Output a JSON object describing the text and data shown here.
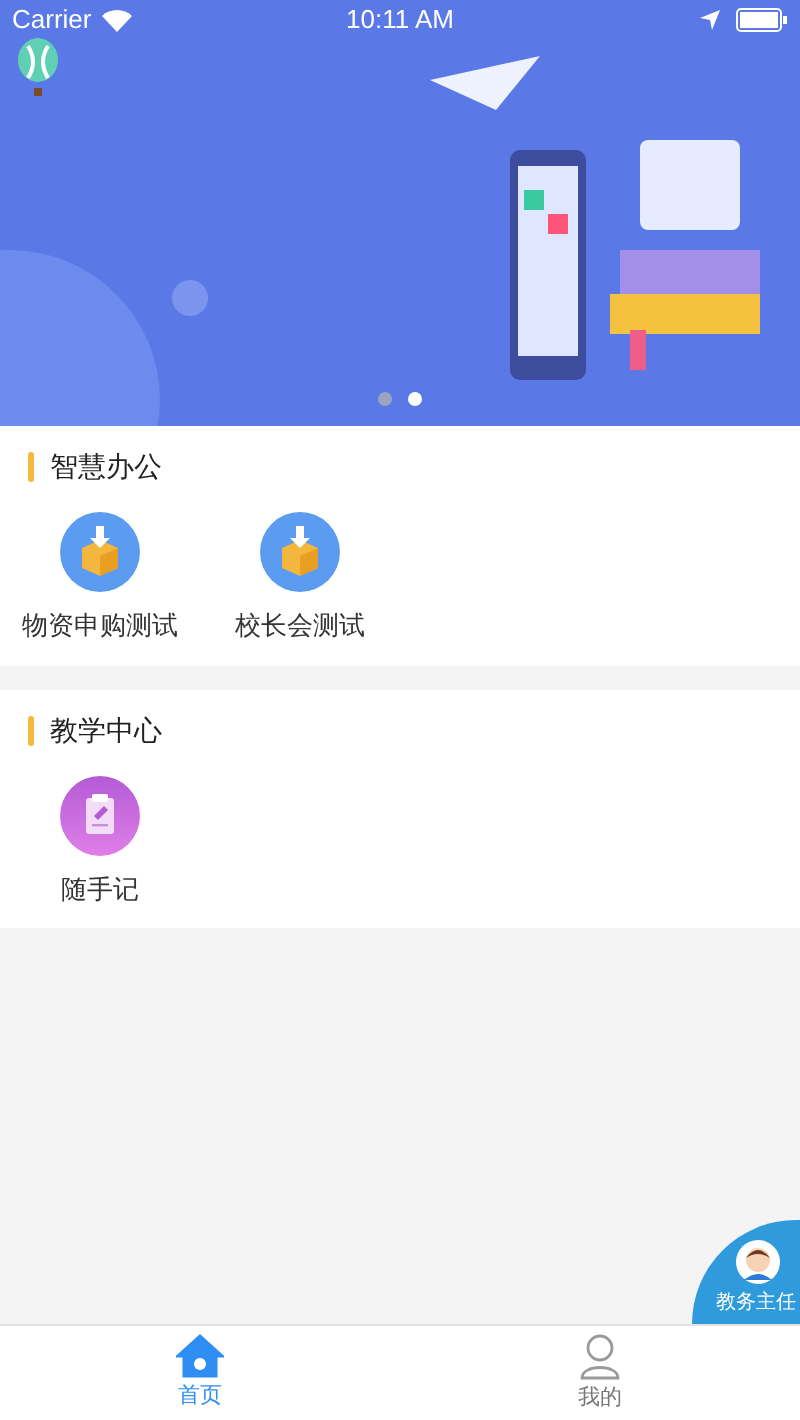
{
  "status_bar": {
    "carrier": "Carrier",
    "time": "10:11 AM"
  },
  "banner": {
    "pages": [
      {
        "selected": false
      },
      {
        "selected": true
      }
    ]
  },
  "sections": [
    {
      "title": "智慧办公",
      "items": [
        {
          "label": "物资申购测试",
          "kind": "box"
        },
        {
          "label": "校长会测试",
          "kind": "box"
        }
      ]
    },
    {
      "title": "教学中心",
      "items": [
        {
          "label": "随手记",
          "kind": "note"
        }
      ]
    }
  ],
  "floating_button": {
    "label": "教务主任"
  },
  "tab_bar": [
    {
      "label": "首页",
      "kind": "home",
      "selected": true
    },
    {
      "label": "我的",
      "kind": "profile",
      "selected": false
    }
  ]
}
